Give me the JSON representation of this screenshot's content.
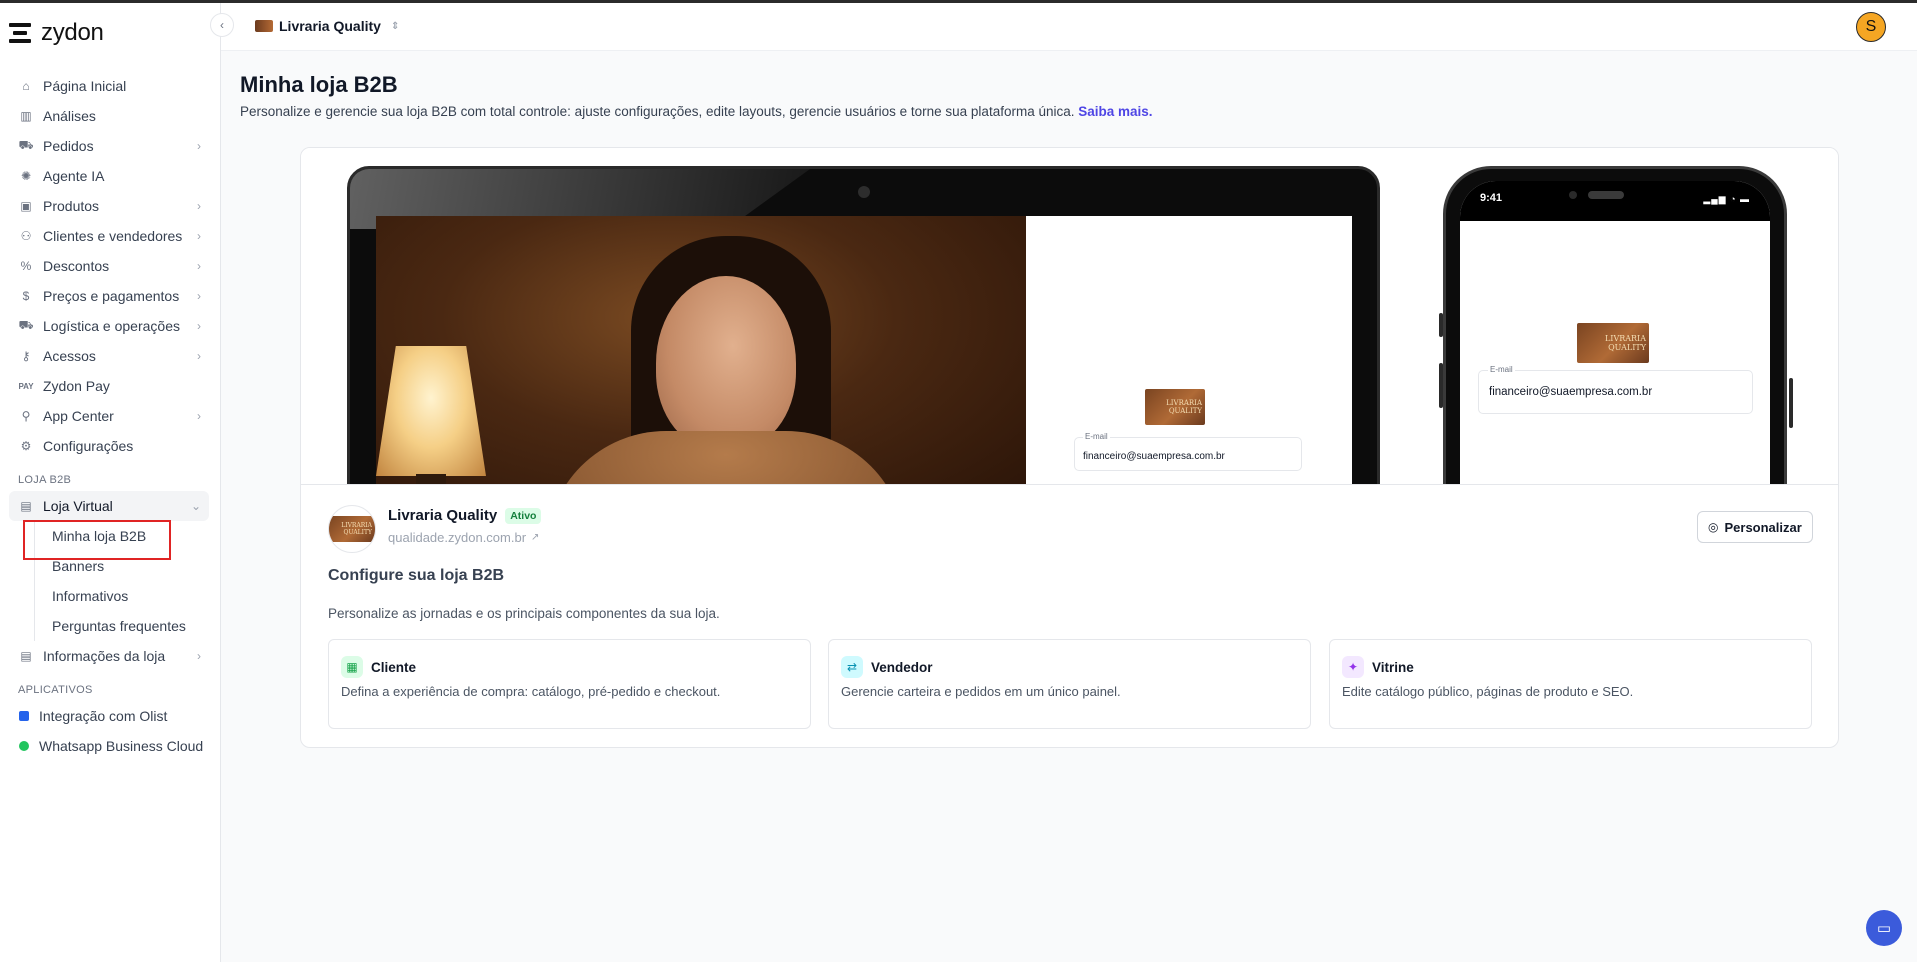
{
  "app": {
    "name": "zydon"
  },
  "header": {
    "store_name": "Livraria Quality",
    "avatar_initial": "S"
  },
  "sidebar": {
    "items": [
      {
        "label": "Página Inicial",
        "icon": "home-icon",
        "chevron": false
      },
      {
        "label": "Análises",
        "icon": "chart-icon",
        "chevron": false
      },
      {
        "label": "Pedidos",
        "icon": "cart-icon",
        "chevron": true
      },
      {
        "label": "Agente IA",
        "icon": "ai-icon",
        "chevron": false
      },
      {
        "label": "Produtos",
        "icon": "box-icon",
        "chevron": true
      },
      {
        "label": "Clientes e vendedores",
        "icon": "users-icon",
        "chevron": true
      },
      {
        "label": "Descontos",
        "icon": "discount-icon",
        "chevron": true
      },
      {
        "label": "Preços e pagamentos",
        "icon": "dollar-icon",
        "chevron": true
      },
      {
        "label": "Logística e operações",
        "icon": "truck-icon",
        "chevron": true
      },
      {
        "label": "Acessos",
        "icon": "key-icon",
        "chevron": true
      },
      {
        "label": "Zydon Pay",
        "icon": "pay-icon",
        "chevron": false
      },
      {
        "label": "App Center",
        "icon": "plug-icon",
        "chevron": true
      },
      {
        "label": "Configurações",
        "icon": "gear-icon",
        "chevron": false
      }
    ],
    "section_b2b": "LOJA B2B",
    "loja_virtual": "Loja Virtual",
    "sub_items": [
      "Minha loja B2B",
      "Banners",
      "Informativos",
      "Perguntas frequentes"
    ],
    "info_loja": "Informações da loja",
    "section_apps": "APLICATIVOS",
    "apps": [
      {
        "label": "Integração com Olist",
        "color": "#2563eb"
      },
      {
        "label": "Whatsapp Business Cloud",
        "color": "#22c55e"
      }
    ]
  },
  "main": {
    "title": "Minha loja B2B",
    "subtitle": "Personalize e gerencie sua loja B2B com total controle: ajuste configurações, edite layouts, gerencie usuários e torne sua plataforma única.",
    "learn_more": "Saiba mais.",
    "preview": {
      "brand_logo_text": "LIVRARIA QUALITY",
      "email_label": "E-mail",
      "email_value": "financeiro@suaempresa.com.br",
      "phone_time": "9:41"
    },
    "store": {
      "name": "Livraria Quality",
      "status": "Ativo",
      "url": "qualidade.zydon.com.br"
    },
    "personalize_label": "Personalizar",
    "config_title": "Configure sua loja B2B",
    "config_subtitle": "Personalize as jornadas e os principais componentes da sua loja.",
    "options": [
      {
        "title": "Cliente",
        "desc": "Defina a experiência de compra: catálogo, pré-pedido e checkout.",
        "icon": "store-icon",
        "color": "#16a34a"
      },
      {
        "title": "Vendedor",
        "desc": "Gerencie carteira e pedidos em um único painel.",
        "icon": "seller-icon",
        "color": "#0891b2"
      },
      {
        "title": "Vitrine",
        "desc": "Edite catálogo público, páginas de produto e SEO.",
        "icon": "showcase-icon",
        "color": "#9333ea"
      }
    ]
  }
}
